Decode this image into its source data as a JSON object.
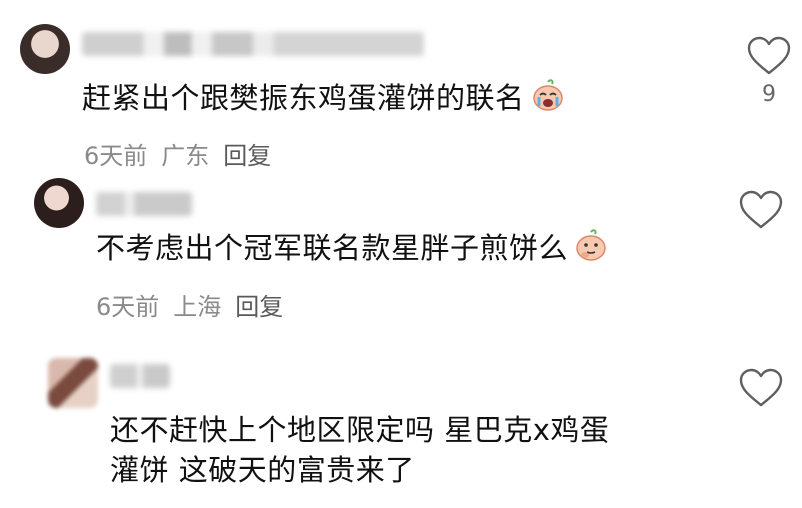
{
  "comments": [
    {
      "text": "赶紧出个跟樊振东鸡蛋灌饼的联名",
      "emoji": "crying-face-emoji",
      "time": "6天前",
      "location": "广东",
      "reply": "回复",
      "likes": "9"
    },
    {
      "text": "不考虑出个冠军联名款星胖子煎饼么",
      "emoji": "thinking-face-emoji",
      "time": "6天前",
      "location": "上海",
      "reply": "回复",
      "likes": ""
    },
    {
      "text_line1": "还不赶快上个地区限定吗 星巴克x鸡蛋",
      "text_line2": "灌饼 这破天的富贵来了",
      "likes": ""
    }
  ],
  "colors": {
    "text": "#111111",
    "meta": "#8a8a8a",
    "icon": "#666666"
  }
}
